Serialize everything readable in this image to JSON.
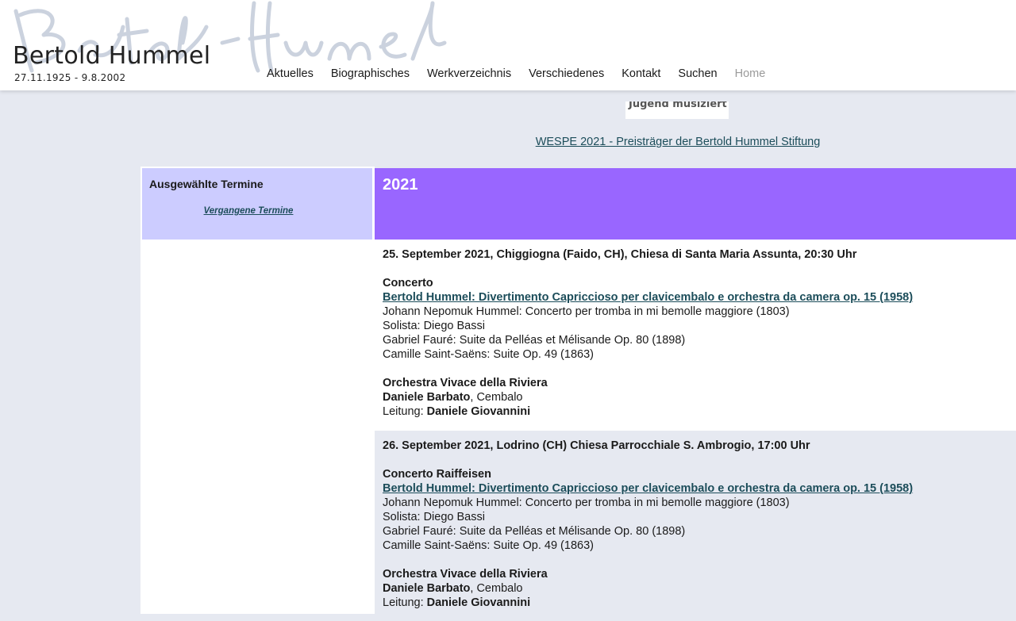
{
  "header": {
    "title": "Bertold Hummel",
    "dates": "27.11.1925 - 9.8.2002",
    "nav": [
      {
        "label": "Aktuelles",
        "active": true
      },
      {
        "label": "Biographisches",
        "active": true
      },
      {
        "label": "Werkverzeichnis",
        "active": true
      },
      {
        "label": "Verschiedenes",
        "active": true
      },
      {
        "label": "Kontakt",
        "active": true
      },
      {
        "label": "Suchen",
        "active": true
      },
      {
        "label": "Home",
        "active": false
      }
    ]
  },
  "banner": {
    "stub_text": "Jugend musiziert",
    "wespe_link": "WESPE 2021 - Preisträger der Bertold Hummel Stiftung"
  },
  "left_panel": {
    "title": "Ausgewählte Termine",
    "link": "Vergangene Termine",
    "bg_color": "#ccccff"
  },
  "content": {
    "year": "2021",
    "year_color": "#9966ff",
    "events": [
      {
        "heading": "25. September 2021, Chiggiogna (Faido, CH), Chiesa di Santa Maria Assunta, 20:30 Uhr",
        "title": "Concerto",
        "work_link": "Bertold Hummel: Divertimento Capriccioso per clavicembalo e orchestra da camera op. 15 (1958)",
        "program": [
          "Johann Nepomuk Hummel: Concerto per tromba in mi bemolle maggiore (1803)",
          "Solista: Diego Bassi",
          "Gabriel Fauré: Suite da Pelléas et Mélisande Op. 80 (1898)",
          "Camille Saint-Saëns: Suite Op. 49 (1863)"
        ],
        "ensemble": "Orchestra Vivace della Riviera",
        "soloist_name": "Daniele Barbato",
        "soloist_role": ", Cembalo",
        "conductor_label": "Leitung: ",
        "conductor_name": "Daniele Giovannini"
      },
      {
        "heading": "26. September 2021, Lodrino (CH) Chiesa Parrocchiale S. Ambrogio, 17:00 Uhr",
        "title": "Concerto Raiffeisen",
        "work_link": "Bertold Hummel: Divertimento Capriccioso per clavicembalo e orchestra da camera op. 15 (1958)",
        "program": [
          "Johann Nepomuk Hummel: Concerto per tromba in mi bemolle maggiore (1803)",
          "Solista: Diego Bassi",
          "Gabriel Fauré: Suite da Pelléas et Mélisande Op. 80 (1898)",
          "Camille Saint-Saëns: Suite Op. 49 (1863)"
        ],
        "ensemble": "Orchestra Vivace della Riviera",
        "soloist_name": "Daniele Barbato",
        "soloist_role": ", Cembalo",
        "conductor_label": "Leitung: ",
        "conductor_name": "Daniele Giovannini"
      }
    ]
  }
}
